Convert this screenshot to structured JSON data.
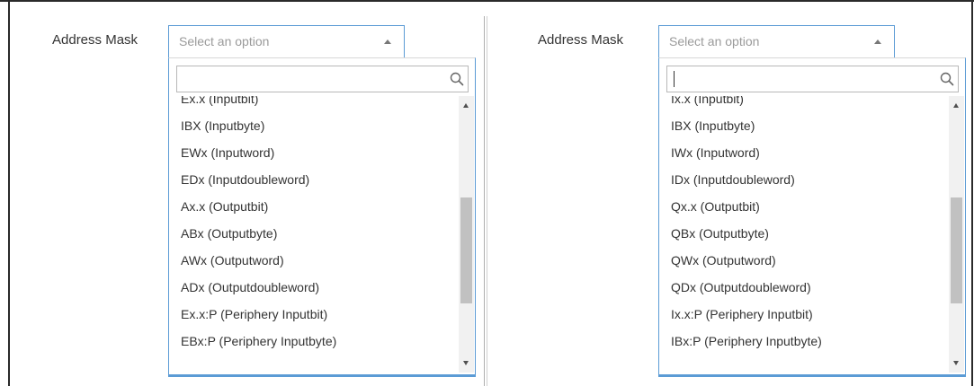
{
  "colors": {
    "accent_border": "#5b9bd5",
    "placeholder_text": "#9a9a9a",
    "scrollbar_track": "#f1f1f1",
    "scrollbar_thumb": "#c1c1c1"
  },
  "left_panel": {
    "label": "Address Mask",
    "select": {
      "placeholder": "Select an option",
      "state": "expanded"
    },
    "search": {
      "value": "",
      "icon": "search-icon"
    },
    "options": [
      "Ex.x (Inputbit)",
      "IBX (Inputbyte)",
      "EWx (Inputword)",
      "EDx (Inputdoubleword)",
      "Ax.x (Outputbit)",
      "ABx (Outputbyte)",
      "AWx (Outputword)",
      "ADx (Outputdoubleword)",
      "Ex.x:P (Periphery Inputbit)",
      "EBx:P (Periphery Inputbyte)"
    ],
    "scroll_position": 0.62
  },
  "right_panel": {
    "label": "Address Mask",
    "select": {
      "placeholder": "Select an option",
      "state": "expanded"
    },
    "search": {
      "value": "",
      "icon": "search-icon",
      "focused": true
    },
    "options": [
      "Ix.x (Inputbit)",
      "IBX (Inputbyte)",
      "IWx (Inputword)",
      "IDx (Inputdoubleword)",
      "Qx.x (Outputbit)",
      "QBx (Outputbyte)",
      "QWx (Outputword)",
      "QDx (Outputdoubleword)",
      "Ix.x:P (Periphery Inputbit)",
      "IBx:P (Periphery Inputbyte)"
    ],
    "scroll_position": 0.62
  }
}
